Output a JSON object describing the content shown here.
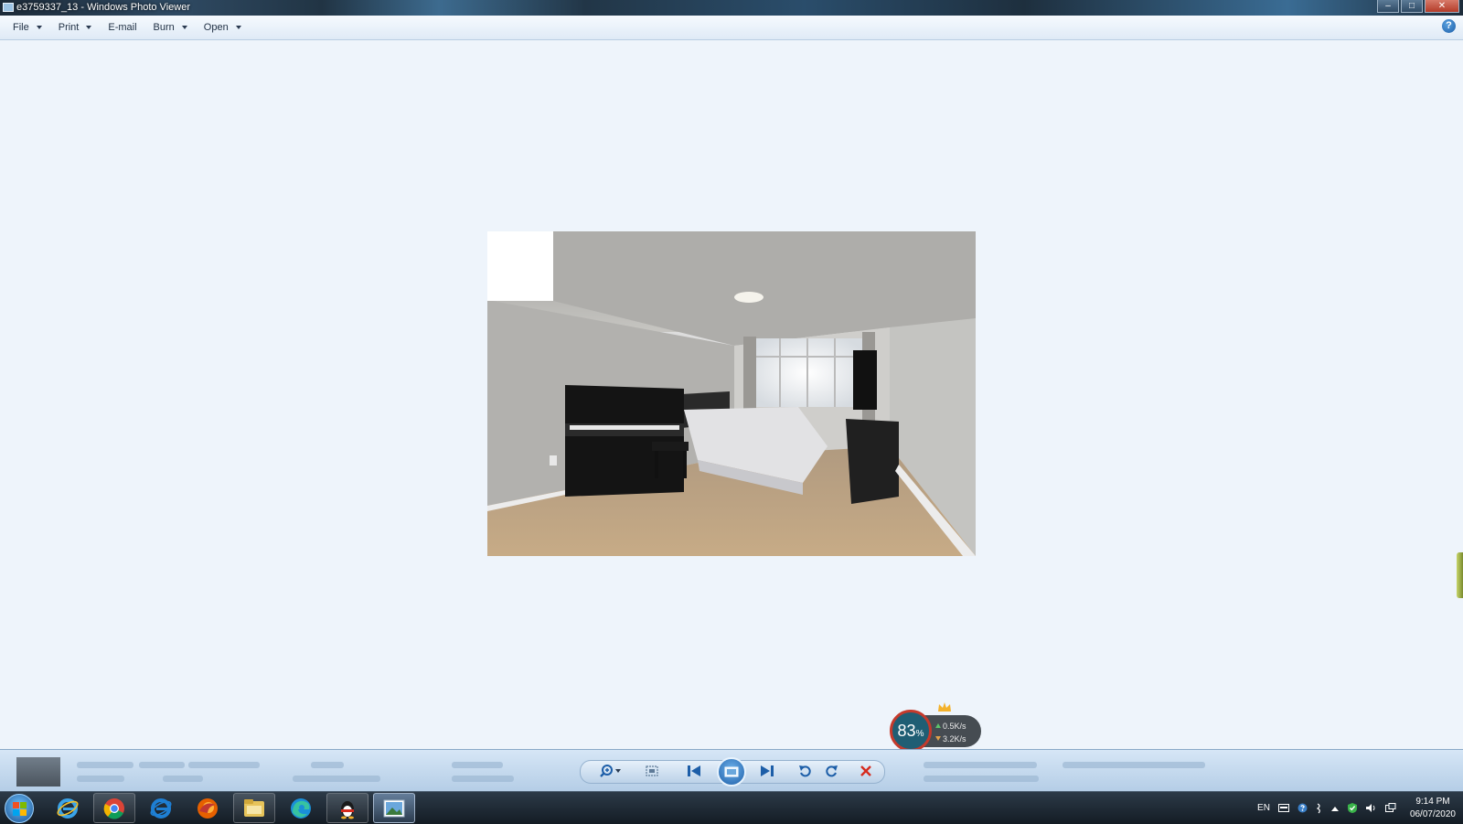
{
  "window": {
    "title": "e3759337_13 - Windows Photo Viewer",
    "buttons": {
      "minimize": "–",
      "maximize": "□",
      "close": "✕"
    }
  },
  "menu": {
    "items": [
      {
        "label": "File",
        "has_dropdown": true
      },
      {
        "label": "Print",
        "has_dropdown": true
      },
      {
        "label": "E-mail",
        "has_dropdown": false
      },
      {
        "label": "Burn",
        "has_dropdown": true
      },
      {
        "label": "Open",
        "has_dropdown": true
      }
    ],
    "help_label": "?"
  },
  "photo": {
    "description_icon": "bedroom-photo"
  },
  "net_monitor": {
    "percent": "83",
    "percent_unit": "%",
    "upload": "0.5K/s",
    "download": "3.2K/s"
  },
  "controls": {
    "icons": [
      "zoom-icon",
      "actual-size-icon",
      "previous-icon",
      "slideshow-icon",
      "next-icon",
      "rotate-left-icon",
      "rotate-right-icon",
      "delete-icon"
    ]
  },
  "taskbar": {
    "apps": [
      "internet-explorer",
      "chrome",
      "internet-explorer-blue",
      "firefox",
      "file-explorer",
      "edge",
      "qq",
      "photo-viewer"
    ],
    "tray": {
      "language": "EN",
      "time": "9:14 PM",
      "date": "06/07/2020"
    }
  },
  "colors": {
    "viewer_bg": "#eef4fb",
    "delete_red": "#d62b1e",
    "accent_blue": "#1d5ea8"
  }
}
